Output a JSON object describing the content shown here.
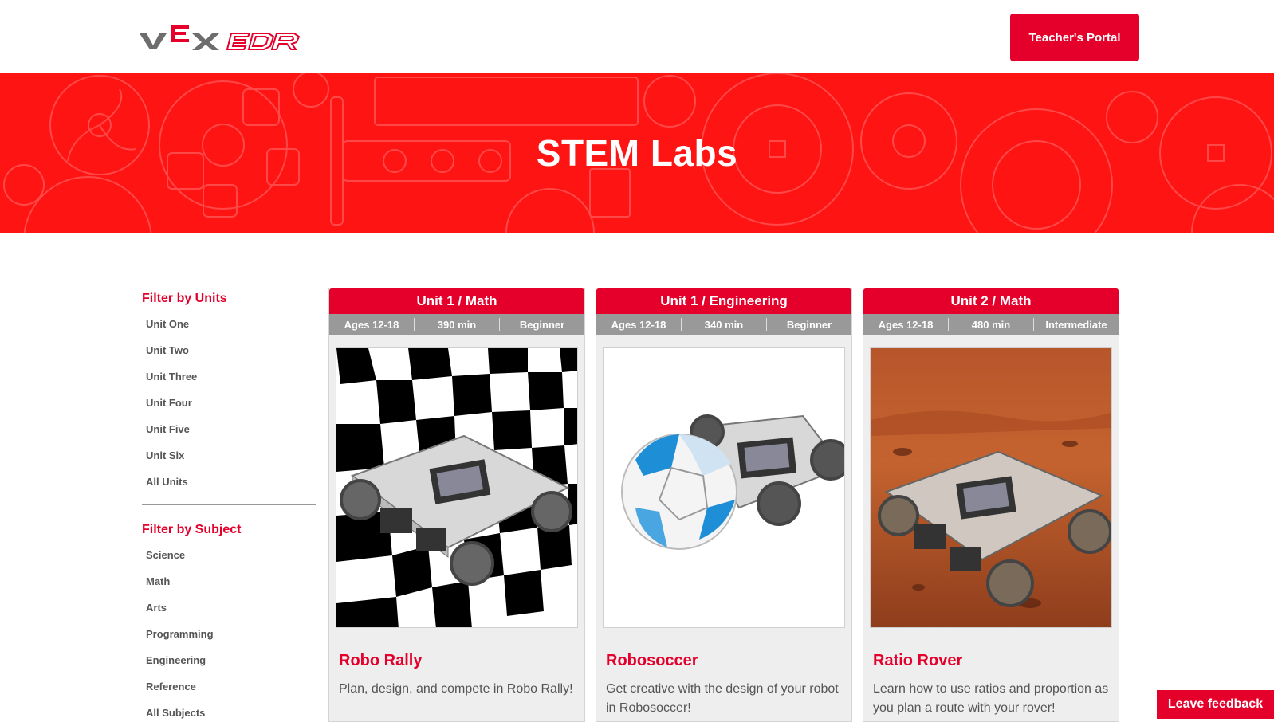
{
  "header": {
    "logo_text": "VEX EDR",
    "portal_button": "Teacher's Portal"
  },
  "banner": {
    "title": "STEM Labs"
  },
  "sidebar": {
    "units_heading": "Filter by Units",
    "units": [
      "Unit One",
      "Unit Two",
      "Unit Three",
      "Unit Four",
      "Unit Five",
      "Unit Six",
      "All Units"
    ],
    "subject_heading": "Filter by Subject",
    "subjects": [
      "Science",
      "Math",
      "Arts",
      "Programming",
      "Engineering",
      "Reference",
      "All Subjects"
    ]
  },
  "cards": [
    {
      "header": "Unit 1 / Math",
      "ages": "Ages 12-18",
      "time": "390 min",
      "level": "Beginner",
      "title": "Robo Rally",
      "description": "Plan, design, and compete in Robo Rally!",
      "image": "checkered-flag-robot"
    },
    {
      "header": "Unit 1 / Engineering",
      "ages": "Ages 12-18",
      "time": "340 min",
      "level": "Beginner",
      "title": "Robosoccer",
      "description": "Get creative with the design of your robot in Robosoccer!",
      "image": "soccer-ball-robot"
    },
    {
      "header": "Unit 2 / Math",
      "ages": "Ages 12-18",
      "time": "480 min",
      "level": "Intermediate",
      "title": "Ratio Rover",
      "description": "Learn how to use ratios and proportion as you plan a route with your rover!",
      "image": "mars-rover-robot"
    }
  ],
  "feedback_button": "Leave feedback",
  "colors": {
    "brand_red": "#e4002b",
    "banner_red": "#ff1414",
    "meta_gray": "#999999",
    "card_bg": "#eeeeee"
  }
}
